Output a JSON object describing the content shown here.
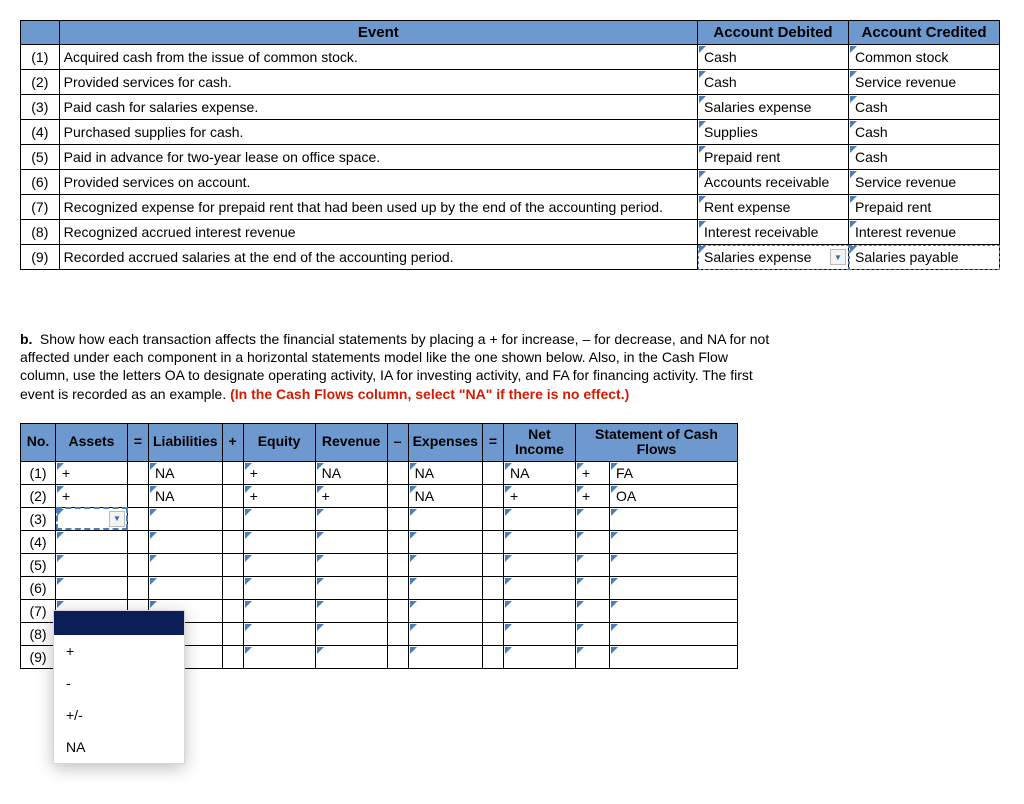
{
  "top_table": {
    "headers": {
      "event": "Event",
      "debited": "Account Debited",
      "credited": "Account Credited"
    },
    "rows": [
      {
        "num": "(1)",
        "event": "Acquired cash from the issue of common stock.",
        "debited": "Cash",
        "credited": "Common stock"
      },
      {
        "num": "(2)",
        "event": "Provided services for cash.",
        "debited": "Cash",
        "credited": "Service revenue"
      },
      {
        "num": "(3)",
        "event": "Paid cash for salaries expense.",
        "debited": "Salaries expense",
        "credited": "Cash"
      },
      {
        "num": "(4)",
        "event": "Purchased supplies for cash.",
        "debited": "Supplies",
        "credited": "Cash"
      },
      {
        "num": "(5)",
        "event": "Paid in advance for two-year lease on office space.",
        "debited": "Prepaid rent",
        "credited": "Cash"
      },
      {
        "num": "(6)",
        "event": "Provided services on account.",
        "debited": "Accounts receivable",
        "credited": "Service revenue"
      },
      {
        "num": "(7)",
        "event": "Recognized expense for prepaid rent that had been used up by the end of the accounting period.",
        "debited": "Rent expense",
        "credited": "Prepaid rent"
      },
      {
        "num": "(8)",
        "event": "Recognized accrued interest revenue",
        "debited": "Interest receivable",
        "credited": "Interest revenue"
      },
      {
        "num": "(9)",
        "event": "Recorded accrued salaries at the end of the accounting period.",
        "debited": "Salaries expense",
        "credited": "Salaries payable"
      }
    ]
  },
  "instruction": {
    "prefix": "b.",
    "text1": "Show how each transaction affects the financial statements by placing a + for increase, – for decrease, and NA for not affected under each component in a horizontal statements model like the one shown below. Also, in the Cash Flow column, use the letters OA to designate operating activity, IA for investing activity, and FA for financing activity. The first event is recorded as an example. ",
    "text_red": "(In the Cash Flows column, select \"NA\" if there is no effect.)"
  },
  "bottom_table": {
    "headers": {
      "no": "No.",
      "assets": "Assets",
      "eq1": "=",
      "liab": "Liabilities",
      "plus": "+",
      "equity": "Equity",
      "revenue": "Revenue",
      "minus": "–",
      "expenses": "Expenses",
      "eq2": "=",
      "net": "Net Income",
      "cash": "Statement of Cash Flows"
    },
    "rows": [
      {
        "num": "(1)",
        "assets": "+",
        "liab": "NA",
        "equity": "+",
        "revenue": "NA",
        "expenses": "NA",
        "net": "NA",
        "cash_sign": "+",
        "cash_type": "FA"
      },
      {
        "num": "(2)",
        "assets": "+",
        "liab": "NA",
        "equity": "+",
        "revenue": "+",
        "expenses": "NA",
        "net": "+",
        "cash_sign": "+",
        "cash_type": "OA"
      },
      {
        "num": "(3)",
        "assets": "",
        "liab": "",
        "equity": "",
        "revenue": "",
        "expenses": "",
        "net": "",
        "cash_sign": "",
        "cash_type": ""
      },
      {
        "num": "(4)",
        "assets": "",
        "liab": "",
        "equity": "",
        "revenue": "",
        "expenses": "",
        "net": "",
        "cash_sign": "",
        "cash_type": ""
      },
      {
        "num": "(5)",
        "assets": "",
        "liab": "",
        "equity": "",
        "revenue": "",
        "expenses": "",
        "net": "",
        "cash_sign": "",
        "cash_type": ""
      },
      {
        "num": "(6)",
        "assets": "",
        "liab": "",
        "equity": "",
        "revenue": "",
        "expenses": "",
        "net": "",
        "cash_sign": "",
        "cash_type": ""
      },
      {
        "num": "(7)",
        "assets": "",
        "liab": "",
        "equity": "",
        "revenue": "",
        "expenses": "",
        "net": "",
        "cash_sign": "",
        "cash_type": ""
      },
      {
        "num": "(8)",
        "assets": "",
        "liab": "",
        "equity": "",
        "revenue": "",
        "expenses": "",
        "net": "",
        "cash_sign": "",
        "cash_type": ""
      },
      {
        "num": "(9)",
        "assets": "",
        "liab": "",
        "equity": "",
        "revenue": "",
        "expenses": "",
        "net": "",
        "cash_sign": "",
        "cash_type": ""
      }
    ]
  },
  "dropdown_options": [
    "",
    "+",
    "-",
    "+/-",
    "NA"
  ]
}
